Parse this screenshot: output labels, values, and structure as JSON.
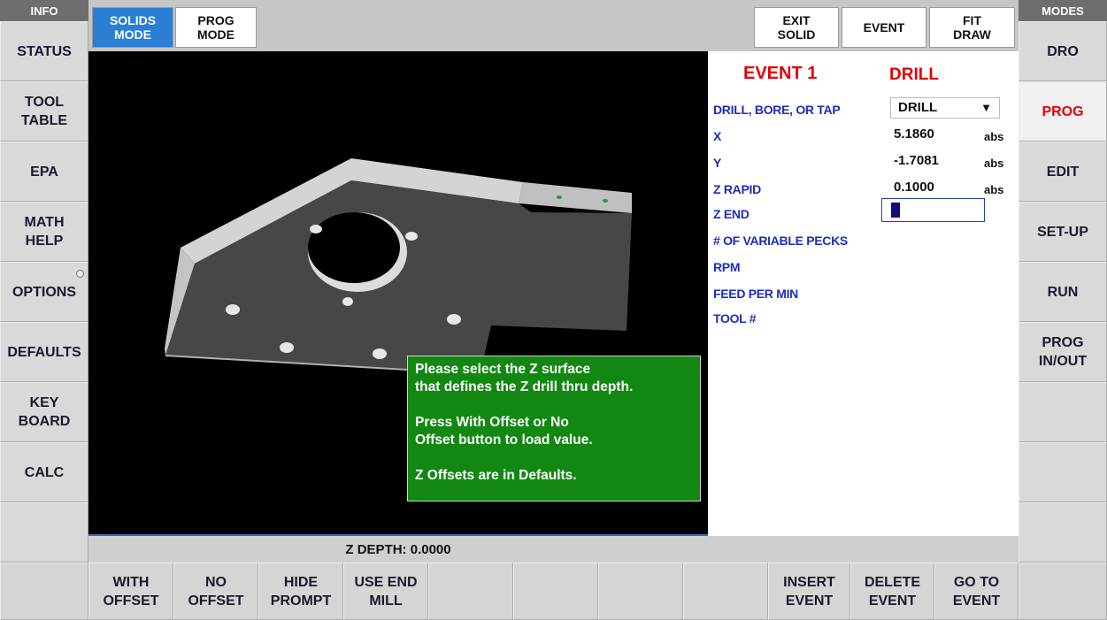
{
  "left_panel": {
    "header": "INFO",
    "buttons": [
      "STATUS",
      "TOOL\nTABLE",
      "EPA",
      "MATH\nHELP",
      "OPTIONS",
      "DEFAULTS",
      "KEY\nBOARD",
      "CALC",
      ""
    ]
  },
  "right_panel": {
    "header": "MODES",
    "buttons": [
      "DRO",
      "PROG",
      "EDIT",
      "SET-UP",
      "RUN",
      "PROG\nIN/OUT",
      "",
      "",
      ""
    ],
    "active": "PROG"
  },
  "top_bar": {
    "solids_mode": "SOLIDS\nMODE",
    "prog_mode": "PROG\nMODE",
    "exit_solid": "EXIT\nSOLID",
    "event": "EVENT",
    "fit_draw": "FIT\nDRAW"
  },
  "event_panel": {
    "title": "EVENT 1",
    "type": "DRILL",
    "fields": [
      {
        "label": "DRILL, BORE, OR TAP",
        "value": "DRILL",
        "unit": ""
      },
      {
        "label": "X",
        "value": "5.1860",
        "unit": "abs"
      },
      {
        "label": "Y",
        "value": "-1.7081",
        "unit": "abs"
      },
      {
        "label": "Z RAPID",
        "value": "0.1000",
        "unit": "abs"
      },
      {
        "label": "Z END",
        "value": "",
        "unit": ""
      },
      {
        "label": "# OF VARIABLE PECKS",
        "value": "",
        "unit": ""
      },
      {
        "label": "RPM",
        "value": "",
        "unit": ""
      },
      {
        "label": "FEED PER MIN",
        "value": "",
        "unit": ""
      },
      {
        "label": "TOOL #",
        "value": "",
        "unit": ""
      }
    ]
  },
  "prompt": {
    "text": "Please select the Z surface\nthat defines the Z  drill thru depth.\n\nPress With Offset or No\nOffset button to load value.\n\nZ Offsets are in Defaults."
  },
  "status_bar": {
    "z_depth": "Z DEPTH: 0.0000"
  },
  "bottom_bar": {
    "buttons": [
      "",
      "WITH\nOFFSET",
      "NO\nOFFSET",
      "HIDE\nPROMPT",
      "USE END\nMILL",
      "",
      "",
      "",
      "",
      "INSERT\nEVENT",
      "DELETE\nEVENT",
      "GO TO\nEVENT",
      ""
    ]
  },
  "colors": {
    "accent": "#2a7fd4",
    "active_text": "#e30000",
    "label_blue": "#1c2dbb",
    "prompt_green": "#128812"
  }
}
